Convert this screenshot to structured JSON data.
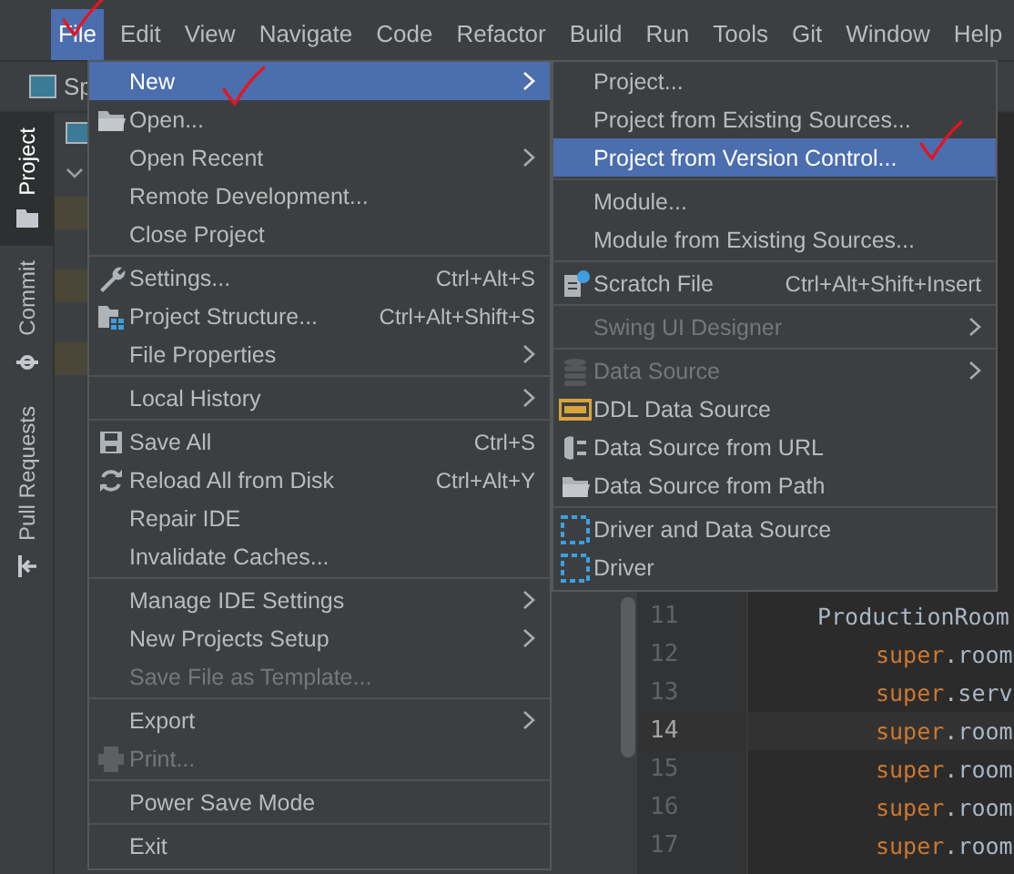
{
  "menubar": {
    "items": [
      {
        "label": "File",
        "selected": true,
        "marked": true
      },
      {
        "label": "Edit",
        "selected": false,
        "marked": false
      },
      {
        "label": "View",
        "selected": false,
        "marked": false
      },
      {
        "label": "Navigate",
        "selected": false,
        "marked": false
      },
      {
        "label": "Code",
        "selected": false,
        "marked": false
      },
      {
        "label": "Refactor",
        "selected": false,
        "marked": false
      },
      {
        "label": "Build",
        "selected": false,
        "marked": false
      },
      {
        "label": "Run",
        "selected": false,
        "marked": false
      },
      {
        "label": "Tools",
        "selected": false,
        "marked": false
      },
      {
        "label": "Git",
        "selected": false,
        "marked": false
      },
      {
        "label": "Window",
        "selected": false,
        "marked": false
      },
      {
        "label": "Help",
        "selected": false,
        "marked": false
      }
    ]
  },
  "toolbar": {
    "tab_label": "Sp"
  },
  "tool_stripe": {
    "tabs": [
      {
        "label": "Project",
        "selected": true
      },
      {
        "label": "Commit",
        "selected": false
      },
      {
        "label": "Pull Requests",
        "selected": false
      }
    ]
  },
  "file_menu": {
    "items": [
      {
        "kind": "item",
        "label": "New",
        "submenu": true,
        "disabled": false,
        "selected": true,
        "marked": true
      },
      {
        "kind": "item",
        "label": "Open...",
        "submenu": false,
        "disabled": false,
        "selected": false,
        "marked": false
      },
      {
        "kind": "item",
        "label": "Open Recent",
        "submenu": true,
        "disabled": false,
        "selected": false,
        "marked": false
      },
      {
        "kind": "item",
        "label": "Remote Development...",
        "submenu": false,
        "disabled": false,
        "selected": false,
        "marked": false
      },
      {
        "kind": "item",
        "label": "Close Project",
        "submenu": false,
        "disabled": false,
        "selected": false,
        "marked": false
      },
      {
        "kind": "separator"
      },
      {
        "kind": "item",
        "label": "Settings...",
        "shortcut": "Ctrl+Alt+S",
        "submenu": false,
        "disabled": false,
        "selected": false,
        "marked": false
      },
      {
        "kind": "item",
        "label": "Project Structure...",
        "shortcut": "Ctrl+Alt+Shift+S",
        "submenu": false,
        "disabled": false,
        "selected": false,
        "marked": false
      },
      {
        "kind": "item",
        "label": "File Properties",
        "submenu": true,
        "disabled": false,
        "selected": false,
        "marked": false
      },
      {
        "kind": "separator"
      },
      {
        "kind": "item",
        "label": "Local History",
        "submenu": true,
        "disabled": false,
        "selected": false,
        "marked": false
      },
      {
        "kind": "separator"
      },
      {
        "kind": "item",
        "label": "Save All",
        "shortcut": "Ctrl+S",
        "submenu": false,
        "disabled": false,
        "selected": false,
        "marked": false
      },
      {
        "kind": "item",
        "label": "Reload All from Disk",
        "shortcut": "Ctrl+Alt+Y",
        "submenu": false,
        "disabled": false,
        "selected": false,
        "marked": false
      },
      {
        "kind": "item",
        "label": "Repair IDE",
        "submenu": false,
        "disabled": false,
        "selected": false,
        "marked": false
      },
      {
        "kind": "item",
        "label": "Invalidate Caches...",
        "submenu": false,
        "disabled": false,
        "selected": false,
        "marked": false
      },
      {
        "kind": "separator"
      },
      {
        "kind": "item",
        "label": "Manage IDE Settings",
        "submenu": true,
        "disabled": false,
        "selected": false,
        "marked": false
      },
      {
        "kind": "item",
        "label": "New Projects Setup",
        "submenu": true,
        "disabled": false,
        "selected": false,
        "marked": false
      },
      {
        "kind": "item",
        "label": "Save File as Template...",
        "submenu": false,
        "disabled": true,
        "selected": false,
        "marked": false
      },
      {
        "kind": "separator"
      },
      {
        "kind": "item",
        "label": "Export",
        "submenu": true,
        "disabled": false,
        "selected": false,
        "marked": false
      },
      {
        "kind": "item",
        "label": "Print...",
        "submenu": false,
        "disabled": true,
        "selected": false,
        "marked": false
      },
      {
        "kind": "separator"
      },
      {
        "kind": "item",
        "label": "Power Save Mode",
        "submenu": false,
        "disabled": false,
        "selected": false,
        "marked": false
      },
      {
        "kind": "separator"
      },
      {
        "kind": "item",
        "label": "Exit",
        "submenu": false,
        "disabled": false,
        "selected": false,
        "marked": false
      }
    ]
  },
  "new_submenu": {
    "items": [
      {
        "kind": "item",
        "label": "Project...",
        "submenu": false,
        "disabled": false,
        "selected": false,
        "marked": false
      },
      {
        "kind": "item",
        "label": "Project from Existing Sources...",
        "submenu": false,
        "disabled": false,
        "selected": false,
        "marked": false
      },
      {
        "kind": "item",
        "label": "Project from Version Control...",
        "submenu": false,
        "disabled": false,
        "selected": true,
        "marked": true
      },
      {
        "kind": "separator"
      },
      {
        "kind": "item",
        "label": "Module...",
        "submenu": false,
        "disabled": false,
        "selected": false,
        "marked": false
      },
      {
        "kind": "item",
        "label": "Module from Existing Sources...",
        "submenu": false,
        "disabled": false,
        "selected": false,
        "marked": false
      },
      {
        "kind": "separator"
      },
      {
        "kind": "item",
        "label": "Scratch File",
        "shortcut": "Ctrl+Alt+Shift+Insert",
        "submenu": false,
        "disabled": false,
        "selected": false,
        "marked": false
      },
      {
        "kind": "separator"
      },
      {
        "kind": "item",
        "label": "Swing UI Designer",
        "submenu": true,
        "disabled": true,
        "selected": false,
        "marked": false
      },
      {
        "kind": "separator"
      },
      {
        "kind": "item",
        "label": "Data Source",
        "submenu": true,
        "disabled": true,
        "selected": false,
        "marked": false
      },
      {
        "kind": "item",
        "label": "DDL Data Source",
        "submenu": false,
        "disabled": false,
        "selected": false,
        "marked": false
      },
      {
        "kind": "item",
        "label": "Data Source from URL",
        "submenu": false,
        "disabled": false,
        "selected": false,
        "marked": false
      },
      {
        "kind": "item",
        "label": "Data Source from Path",
        "submenu": false,
        "disabled": false,
        "selected": false,
        "marked": false
      },
      {
        "kind": "separator"
      },
      {
        "kind": "item",
        "label": "Driver and Data Source",
        "submenu": false,
        "disabled": false,
        "selected": false,
        "marked": false
      },
      {
        "kind": "item",
        "label": "Driver",
        "submenu": false,
        "disabled": false,
        "selected": false,
        "marked": false
      }
    ]
  },
  "editor": {
    "lines": [
      {
        "number": "11",
        "current": false,
        "parts": [
          {
            "kind": "plain",
            "text": "ProductionRoom"
          }
        ]
      },
      {
        "number": "12",
        "current": false,
        "parts": [
          {
            "kind": "keyword",
            "text": "super"
          },
          {
            "kind": "plain",
            "text": ".room"
          }
        ]
      },
      {
        "number": "13",
        "current": false,
        "parts": [
          {
            "kind": "keyword",
            "text": "super"
          },
          {
            "kind": "plain",
            "text": ".serv"
          }
        ]
      },
      {
        "number": "14",
        "current": true,
        "parts": [
          {
            "kind": "keyword",
            "text": "super"
          },
          {
            "kind": "plain",
            "text": ".room"
          }
        ]
      },
      {
        "number": "15",
        "current": false,
        "parts": [
          {
            "kind": "keyword",
            "text": "super"
          },
          {
            "kind": "plain",
            "text": ".room"
          }
        ]
      },
      {
        "number": "16",
        "current": false,
        "parts": [
          {
            "kind": "keyword",
            "text": "super"
          },
          {
            "kind": "plain",
            "text": ".room"
          }
        ]
      },
      {
        "number": "17",
        "current": false,
        "parts": [
          {
            "kind": "keyword",
            "text": "super"
          },
          {
            "kind": "plain",
            "text": ".room"
          }
        ]
      }
    ]
  }
}
